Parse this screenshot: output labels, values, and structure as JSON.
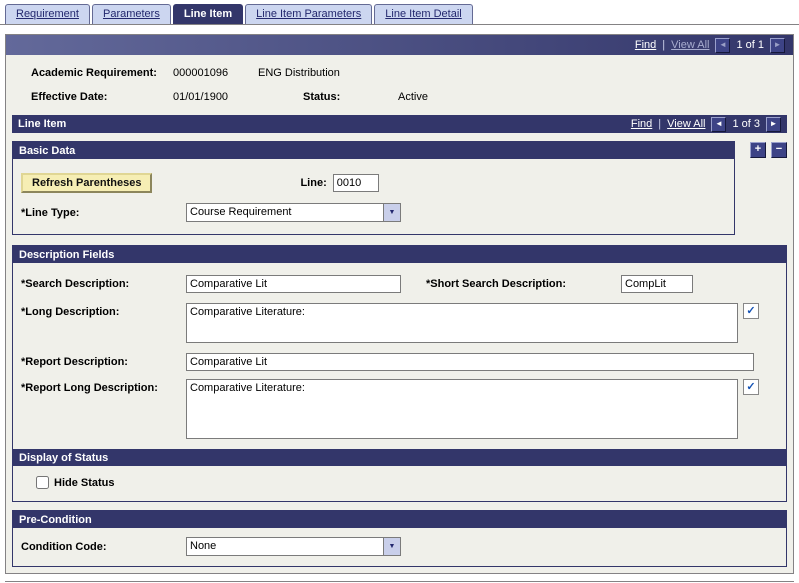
{
  "tabs": [
    {
      "label": "Requirement"
    },
    {
      "label": "Parameters"
    },
    {
      "label": "Line Item"
    },
    {
      "label": "Line Item Parameters"
    },
    {
      "label": "Line Item Detail"
    }
  ],
  "page_toolbar": {
    "find": "Find",
    "separator": "|",
    "view_all": "View All",
    "position": "1 of 1"
  },
  "header": {
    "academic_requirement_label": "Academic Requirement:",
    "academic_requirement_value": "000001096",
    "academic_requirement_description": "ENG Distribution",
    "effective_date_label": "Effective Date:",
    "effective_date_value": "01/01/1900",
    "status_label": "Status:",
    "status_value": "Active"
  },
  "line_item_section": {
    "title": "Line Item",
    "find": "Find",
    "separator": "|",
    "view_all": "View All",
    "position": "1 of 3"
  },
  "basic_data": {
    "title": "Basic Data",
    "refresh_button_label": "Refresh Parentheses",
    "line_label": "Line:",
    "line_value": "0010",
    "line_type_label": "*Line Type:",
    "line_type_value": "Course Requirement"
  },
  "description_fields": {
    "title": "Description Fields",
    "search_description_label": "*Search Description:",
    "search_description_value": "Comparative Lit",
    "short_search_description_label": "*Short Search Description:",
    "short_search_description_value": "CompLit",
    "long_description_label": "*Long Description:",
    "long_description_value": "Comparative Literature:",
    "report_description_label": "*Report Description:",
    "report_description_value": "Comparative Lit",
    "report_long_description_label": "*Report Long Description:",
    "report_long_description_value": "Comparative Literature:"
  },
  "display_of_status": {
    "title": "Display of Status",
    "hide_status_label": "Hide Status"
  },
  "pre_condition": {
    "title": "Pre-Condition",
    "condition_code_label": "Condition Code:",
    "condition_code_value": "None"
  },
  "icons": {
    "add": "+",
    "delete": "−",
    "prev": "◄",
    "next": "►",
    "dropdown": "▼",
    "spellcheck": "✓"
  },
  "colors": {
    "header_bar": "#33366A",
    "tab_inactive_bg": "#CCD6F0",
    "content_bg": "#F0F0EA",
    "button_bg": "#F6EEB4"
  }
}
